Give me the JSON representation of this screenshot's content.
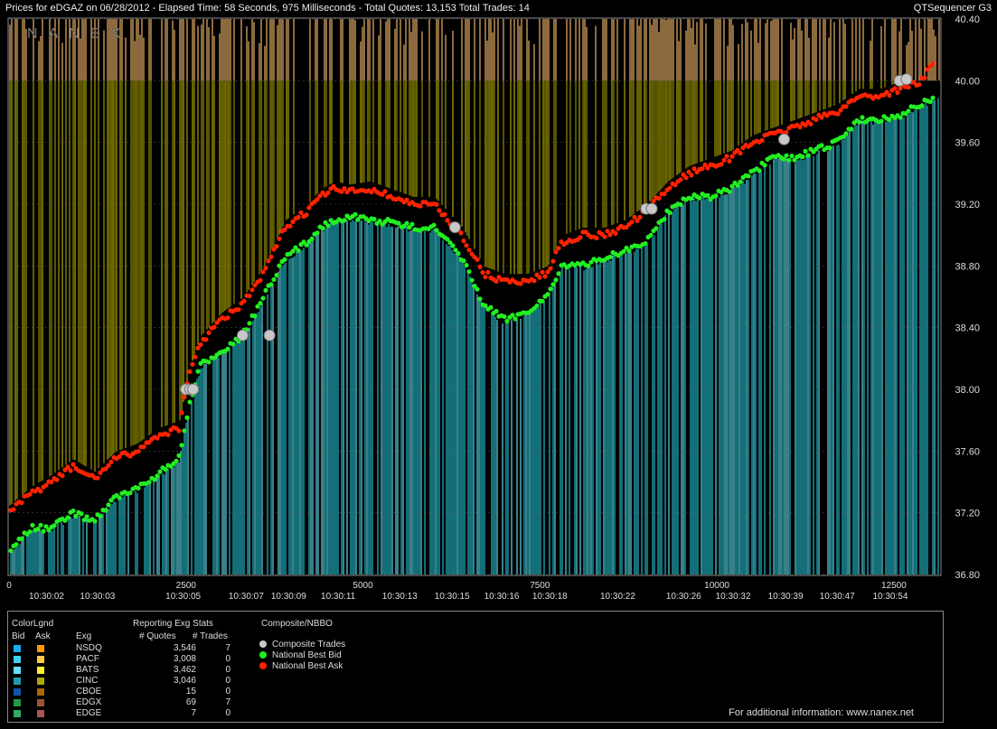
{
  "header": {
    "title": "Prices for  eDGAZ  on  06/28/2012  -  Elapsed Time: 58 Seconds, 975 Milliseconds  -  Total Quotes: 13,153  Total Trades: 14",
    "app_name": "QTSequencer G3"
  },
  "watermark": "NANEX",
  "colors": {
    "background": "#000000",
    "bid_bar": "#21b8c8",
    "ask_bar_lower": "#c8c000",
    "ask_bar_upper": "#ffc070",
    "bid_marker": "#22ee22",
    "ask_marker": "#ff2200",
    "trade_marker": "#c8c8c8"
  },
  "legend": {
    "colorlegend_label": "ColorLgnd",
    "bid_label": "Bid",
    "ask_label": "Ask",
    "exg_label": "Exg",
    "stats_label": "Reporting Exg Stats",
    "quotes_label": "# Quotes",
    "trades_label": "# Trades",
    "composite_label": "Composite/NBBO",
    "exchanges": [
      {
        "name": "NSDQ",
        "quotes": "3,546",
        "trades": "7",
        "bid_color": "#22aaee",
        "ask_color": "#ff9900"
      },
      {
        "name": "PACF",
        "quotes": "3,008",
        "trades": "0",
        "bid_color": "#44ccee",
        "ask_color": "#ffcc44"
      },
      {
        "name": "BATS",
        "quotes": "3,462",
        "trades": "0",
        "bid_color": "#66ddff",
        "ask_color": "#ffee33"
      },
      {
        "name": "CINC",
        "quotes": "3,046",
        "trades": "0",
        "bid_color": "#2299aa",
        "ask_color": "#aaaa00"
      },
      {
        "name": "CBOE",
        "quotes": "15",
        "trades": "0",
        "bid_color": "#1155aa",
        "ask_color": "#aa6600"
      },
      {
        "name": "EDGX",
        "quotes": "69",
        "trades": "7",
        "bid_color": "#229944",
        "ask_color": "#995533"
      },
      {
        "name": "EDGE",
        "quotes": "7",
        "trades": "0",
        "bid_color": "#33aa66",
        "ask_color": "#aa5555"
      }
    ],
    "composite": [
      {
        "label": "Composite Trades",
        "color": "#c8c8c8"
      },
      {
        "label": "National Best Bid",
        "color": "#22ee22"
      },
      {
        "label": "National Best Ask",
        "color": "#ff2200"
      }
    ],
    "footer": "For additional information: www.nanex.net"
  },
  "chart_data": {
    "type": "line",
    "title": "Prices for  eDGAZ  on  06/28/2012",
    "ylim": [
      36.8,
      40.4
    ],
    "xlim": [
      0,
      13153
    ],
    "y_ticks": [
      "40.40",
      "40.00",
      "39.60",
      "39.20",
      "38.80",
      "38.40",
      "38.00",
      "37.60",
      "37.20",
      "36.80"
    ],
    "x_count_ticks": [
      {
        "x": 0,
        "label": "0"
      },
      {
        "x": 2500,
        "label": "2500"
      },
      {
        "x": 5000,
        "label": "5000"
      },
      {
        "x": 7500,
        "label": "7500"
      },
      {
        "x": 10000,
        "label": "10000"
      },
      {
        "x": 12500,
        "label": "12500"
      }
    ],
    "x_time_ticks": [
      {
        "x": 530,
        "label": "10:30:02"
      },
      {
        "x": 1250,
        "label": "10:30:03"
      },
      {
        "x": 2460,
        "label": "10:30:05"
      },
      {
        "x": 3350,
        "label": "10:30:07"
      },
      {
        "x": 3950,
        "label": "10:30:09"
      },
      {
        "x": 4650,
        "label": "10:30:11"
      },
      {
        "x": 5520,
        "label": "10:30:13"
      },
      {
        "x": 6260,
        "label": "10:30:15"
      },
      {
        "x": 6960,
        "label": "10:30:16"
      },
      {
        "x": 7640,
        "label": "10:30:18"
      },
      {
        "x": 8600,
        "label": "10:30:22"
      },
      {
        "x": 9530,
        "label": "10:30:26"
      },
      {
        "x": 10230,
        "label": "10:30:32"
      },
      {
        "x": 10970,
        "label": "10:30:39"
      },
      {
        "x": 11700,
        "label": "10:30:47"
      },
      {
        "x": 12450,
        "label": "10:30:54"
      }
    ],
    "series": [
      {
        "name": "National Best Bid",
        "x": [
          0,
          300,
          600,
          900,
          1200,
          1500,
          1800,
          2100,
          2400,
          2550,
          2700,
          3000,
          3300,
          3600,
          3900,
          4200,
          4400,
          4600,
          4800,
          5100,
          5400,
          5700,
          6000,
          6200,
          6400,
          6700,
          7000,
          7300,
          7600,
          7800,
          8100,
          8400,
          8700,
          9000,
          9300,
          9600,
          9900,
          10200,
          10500,
          10800,
          11100,
          11400,
          11700,
          12000,
          12300,
          12600,
          12900,
          13100
        ],
        "y": [
          36.95,
          37.1,
          37.1,
          37.2,
          37.15,
          37.3,
          37.35,
          37.45,
          37.55,
          37.9,
          38.15,
          38.25,
          38.35,
          38.6,
          38.85,
          38.95,
          39.05,
          39.1,
          39.12,
          39.1,
          39.08,
          39.05,
          39.05,
          38.95,
          38.85,
          38.55,
          38.45,
          38.5,
          38.6,
          38.8,
          38.8,
          38.85,
          38.9,
          38.95,
          39.15,
          39.25,
          39.25,
          39.3,
          39.4,
          39.5,
          39.5,
          39.55,
          39.6,
          39.75,
          39.75,
          39.78,
          39.85,
          39.9
        ]
      },
      {
        "name": "National Best Ask",
        "x": [
          0,
          300,
          600,
          900,
          1200,
          1500,
          1800,
          2100,
          2400,
          2550,
          2700,
          3000,
          3300,
          3600,
          3900,
          4200,
          4400,
          4600,
          4800,
          5100,
          5400,
          5700,
          6000,
          6200,
          6400,
          6700,
          7000,
          7300,
          7600,
          7800,
          8100,
          8400,
          8700,
          9000,
          9300,
          9600,
          9900,
          10200,
          10500,
          10800,
          11100,
          11400,
          11700,
          12000,
          12300,
          12600,
          12900,
          13100
        ],
        "y": [
          37.2,
          37.32,
          37.4,
          37.5,
          37.42,
          37.55,
          37.6,
          37.7,
          37.75,
          38.1,
          38.3,
          38.45,
          38.55,
          38.75,
          39.05,
          39.15,
          39.25,
          39.3,
          39.28,
          39.3,
          39.25,
          39.2,
          39.2,
          39.1,
          39.0,
          38.75,
          38.7,
          38.7,
          38.75,
          38.95,
          39.0,
          39.0,
          39.05,
          39.15,
          39.3,
          39.4,
          39.45,
          39.5,
          39.6,
          39.65,
          39.7,
          39.75,
          39.8,
          39.9,
          39.9,
          39.95,
          40.0,
          40.15
        ]
      },
      {
        "name": "Composite Trades",
        "type": "scatter",
        "x": [
          2500,
          2560,
          2600,
          3300,
          3680,
          6300,
          9000,
          9080,
          10950,
          12580,
          12680
        ],
        "y": [
          38.0,
          38.0,
          38.0,
          38.35,
          38.35,
          39.05,
          39.17,
          39.17,
          39.62,
          40.0,
          40.01
        ]
      }
    ]
  }
}
